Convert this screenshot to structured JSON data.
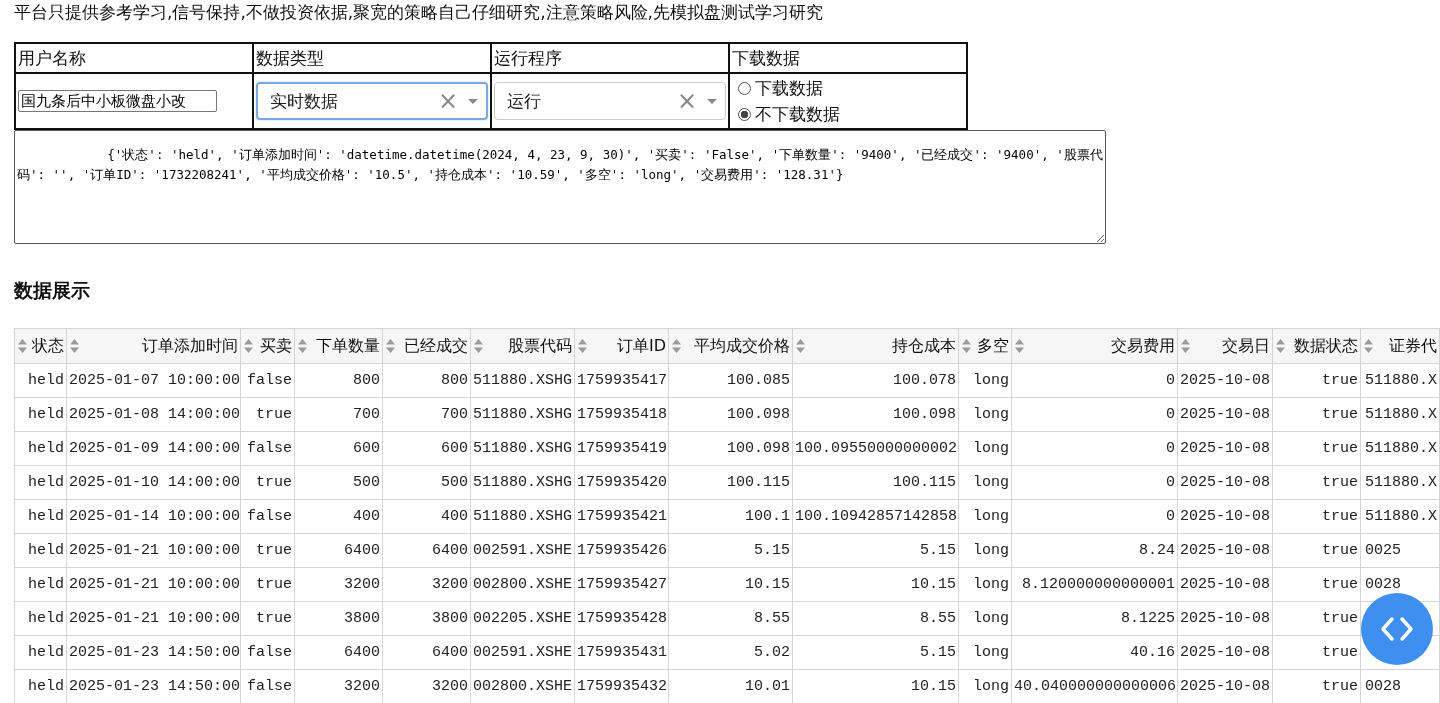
{
  "notice": "平台只提供参考学习,信号保持,不做投资依据,聚宽的策略自己仔细研究,注意策略风险,先模拟盘测试学习研究",
  "form": {
    "headers": [
      "用户名称",
      "数据类型",
      "运行程序",
      "下载数据"
    ],
    "username": {
      "value": "国九条后中小板微盘小改"
    },
    "selects": [
      {
        "value": "实时数据",
        "clear": "×",
        "focused": true
      },
      {
        "value": "运行",
        "clear": "×",
        "focused": false
      }
    ],
    "download_options": [
      {
        "label": "下载数据",
        "selected": false
      },
      {
        "label": "不下载数据",
        "selected": true
      }
    ]
  },
  "output": {
    "value": "            {'状态': 'held', '订单添加时间': 'datetime.datetime(2024, 4, 23, 9, 30)', '买卖': 'False', '下单数量': '9400', '已经成交': '9400', '股票代码': '', '订单ID': '1732208241', '平均成交价格': '10.5', '持仓成本': '10.59', '多空': 'long', '交易费用': '128.31'}"
  },
  "section_title": "数据展示",
  "table": {
    "columns": [
      "状态",
      "订单添加时间",
      "买卖",
      "下单数量",
      "已经成交",
      "股票代码",
      "订单ID",
      "平均成交价格",
      "持仓成本",
      "多空",
      "交易费用",
      "交易日",
      "数据状态",
      "证券代"
    ],
    "rows": [
      [
        "held",
        "2025-01-07 10:00:00",
        "false",
        "800",
        "800",
        "511880.XSHG",
        "1759935417",
        "100.085",
        "100.078",
        "long",
        "0",
        "2025-10-08",
        "true",
        "511880.X"
      ],
      [
        "held",
        "2025-01-08 14:00:00",
        "true",
        "700",
        "700",
        "511880.XSHG",
        "1759935418",
        "100.098",
        "100.098",
        "long",
        "0",
        "2025-10-08",
        "true",
        "511880.X"
      ],
      [
        "held",
        "2025-01-09 14:00:00",
        "false",
        "600",
        "600",
        "511880.XSHG",
        "1759935419",
        "100.098",
        "100.09550000000002",
        "long",
        "0",
        "2025-10-08",
        "true",
        "511880.X"
      ],
      [
        "held",
        "2025-01-10 14:00:00",
        "true",
        "500",
        "500",
        "511880.XSHG",
        "1759935420",
        "100.115",
        "100.115",
        "long",
        "0",
        "2025-10-08",
        "true",
        "511880.X"
      ],
      [
        "held",
        "2025-01-14 10:00:00",
        "false",
        "400",
        "400",
        "511880.XSHG",
        "1759935421",
        "100.1",
        "100.10942857142858",
        "long",
        "0",
        "2025-10-08",
        "true",
        "511880.X"
      ],
      [
        "held",
        "2025-01-21 10:00:00",
        "true",
        "6400",
        "6400",
        "002591.XSHE",
        "1759935426",
        "5.15",
        "5.15",
        "long",
        "8.24",
        "2025-10-08",
        "true",
        "0025"
      ],
      [
        "held",
        "2025-01-21 10:00:00",
        "true",
        "3200",
        "3200",
        "002800.XSHE",
        "1759935427",
        "10.15",
        "10.15",
        "long",
        "8.120000000000001",
        "2025-10-08",
        "true",
        "0028"
      ],
      [
        "held",
        "2025-01-21 10:00:00",
        "true",
        "3800",
        "3800",
        "002205.XSHE",
        "1759935428",
        "8.55",
        "8.55",
        "long",
        "8.1225",
        "2025-10-08",
        "true",
        null
      ],
      [
        "held",
        "2025-01-23 14:50:00",
        "false",
        "6400",
        "6400",
        "002591.XSHE",
        "1759935431",
        "5.02",
        "5.15",
        "long",
        "40.16",
        "2025-10-08",
        "true",
        null
      ],
      [
        "held",
        "2025-01-23 14:50:00",
        "false",
        "3200",
        "3200",
        "002800.XSHE",
        "1759935432",
        "10.01",
        "10.15",
        "long",
        "40.040000000000006",
        "2025-10-08",
        "true",
        "0028"
      ]
    ]
  }
}
